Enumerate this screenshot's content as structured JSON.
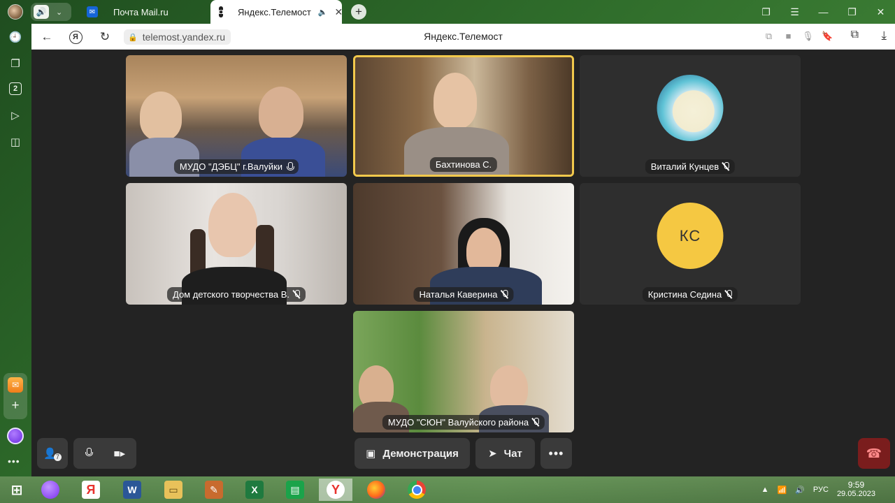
{
  "browser": {
    "tabs": [
      {
        "label": "Почта Mail.ru",
        "favicon": "mail-ru-icon",
        "active": false
      },
      {
        "label": "Яндекс.Телемост",
        "favicon": "telemost-icon",
        "active": true
      }
    ],
    "address": {
      "url": "telemost.yandex.ru",
      "page_title": "Яндекс.Телемост"
    },
    "sidebar_tabs_count": "2"
  },
  "call": {
    "participants": [
      {
        "name": "МУДО \"ДЭБЦ\" г.Валуйки",
        "muted": false,
        "speaking": false,
        "video": true
      },
      {
        "name": "Бахтинова С.",
        "muted": false,
        "speaking": true,
        "video": true
      },
      {
        "name": "Виталий Кунцев",
        "muted": true,
        "speaking": false,
        "video": false,
        "avatar": "illustrated-avatar"
      },
      {
        "name": "Дом детского творчества В.",
        "muted": true,
        "speaking": false,
        "video": true
      },
      {
        "name": "Наталья Каверина",
        "muted": true,
        "speaking": false,
        "video": true
      },
      {
        "name": "Кристина Седина",
        "muted": true,
        "speaking": false,
        "video": false,
        "initials": "КС"
      },
      {
        "name": "МУДО \"СЮН\" Валуйского района",
        "muted": true,
        "speaking": false,
        "video": true
      }
    ],
    "controls": {
      "add_participant_badge": "7",
      "demo_label": "Демонстрация",
      "chat_label": "Чат"
    },
    "colors": {
      "speaking_border": "#f2c94c",
      "initials_avatar": "#f5c842",
      "hangup": "#7a1d1d"
    }
  },
  "taskbar": {
    "language": "РУС",
    "time": "9:59",
    "date": "29.05.2023"
  }
}
